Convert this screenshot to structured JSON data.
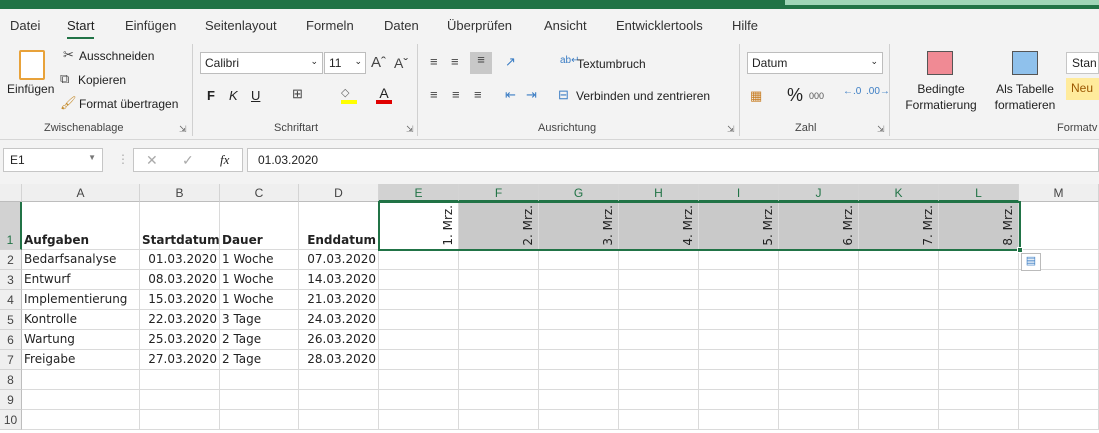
{
  "ribbon_tabs": [
    "Datei",
    "Start",
    "Einfügen",
    "Seitenlayout",
    "Formeln",
    "Daten",
    "Überprüfen",
    "Ansicht",
    "Entwicklertools",
    "Hilfe"
  ],
  "active_tab": "Start",
  "clipboard": {
    "paste": "Einfügen",
    "cut": "Ausschneiden",
    "copy": "Kopieren",
    "format_painter": "Format übertragen",
    "group": "Zwischenablage"
  },
  "font": {
    "name": "Calibri",
    "size": "11",
    "bold": "F",
    "italic": "K",
    "underline": "U",
    "group": "Schriftart",
    "fill_color": "#ffff00",
    "font_color": "#e00000"
  },
  "alignment": {
    "wrap": "Textumbruch",
    "merge": "Verbinden und zentrieren",
    "group": "Ausrichtung"
  },
  "number": {
    "format": "Datum",
    "percent": "%",
    "thousands": "000",
    "group": "Zahl"
  },
  "styles": {
    "conditional": [
      "Bedingte",
      "Formatierung"
    ],
    "as_table": [
      "Als Tabelle",
      "formatieren"
    ],
    "standard": "Stan",
    "neutral": "Neu",
    "group": "Formatv"
  },
  "formula_bar": {
    "name_box": "E1",
    "value": "01.03.2020",
    "fx": "fx"
  },
  "columns": [
    "A",
    "B",
    "C",
    "D",
    "E",
    "F",
    "G",
    "H",
    "I",
    "J",
    "K",
    "L",
    "M"
  ],
  "rows": [
    "1",
    "2",
    "3",
    "4",
    "5",
    "6",
    "7",
    "8",
    "9",
    "10"
  ],
  "headers": [
    "Aufgaben",
    "Startdatum",
    "Dauer",
    "Enddatum"
  ],
  "date_headers": [
    "1. Mrz.",
    "2. Mrz.",
    "3. Mrz.",
    "4. Mrz.",
    "5. Mrz.",
    "6. Mrz.",
    "7. Mrz.",
    "8. Mrz."
  ],
  "tasks": [
    [
      "Bedarfsanalyse",
      "01.03.2020",
      "1 Woche",
      "07.03.2020"
    ],
    [
      "Entwurf",
      "08.03.2020",
      "1 Woche",
      "14.03.2020"
    ],
    [
      "Implementierung",
      "15.03.2020",
      "1 Woche",
      "21.03.2020"
    ],
    [
      "Kontrolle",
      "22.03.2020",
      "3 Tage",
      "24.03.2020"
    ],
    [
      "Wartung",
      "25.03.2020",
      "2 Tage",
      "26.03.2020"
    ],
    [
      "Freigabe",
      "27.03.2020",
      "2 Tage",
      "28.03.2020"
    ]
  ],
  "accent": "#217346"
}
